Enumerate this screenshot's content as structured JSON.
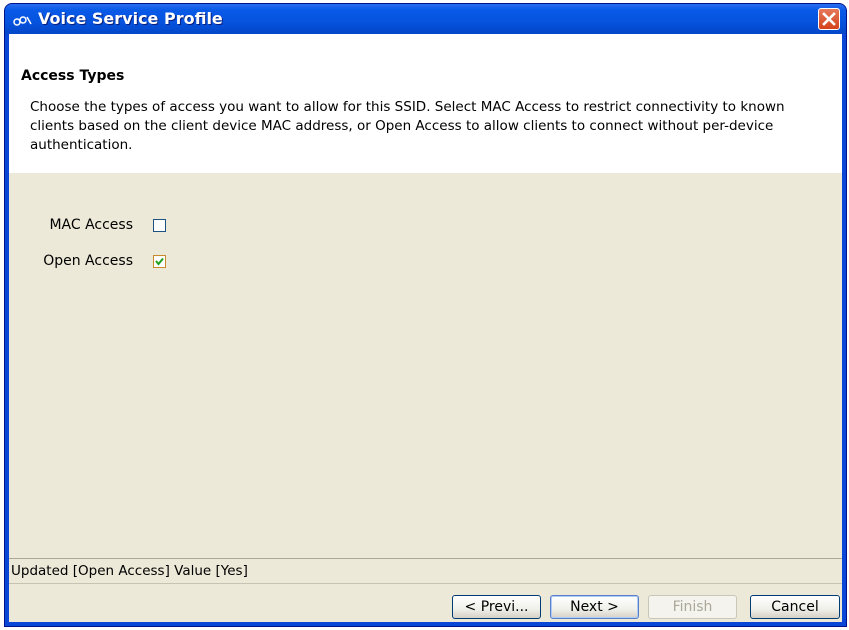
{
  "window": {
    "title": "Voice Service Profile",
    "title_bar_color": "#0a5ae8",
    "close_button_color": "#d4421b"
  },
  "header": {
    "section_title": "Access Types",
    "description": "Choose the types of access you want to allow for this SSID. Select MAC Access to restrict connectivity to known clients based on the client device MAC address, or Open Access to allow clients to connect without per-device authentication."
  },
  "options": [
    {
      "label": "MAC Access",
      "checked": false
    },
    {
      "label": "Open Access",
      "checked": true
    }
  ],
  "status": {
    "text": "Updated [Open Access] Value [Yes]"
  },
  "buttons": {
    "previous": "< Previ...",
    "next": "Next >",
    "finish": "Finish",
    "cancel": "Cancel"
  },
  "icons": {
    "app": "app-logo-icon",
    "close": "close-icon",
    "check": "checkmark-icon"
  }
}
